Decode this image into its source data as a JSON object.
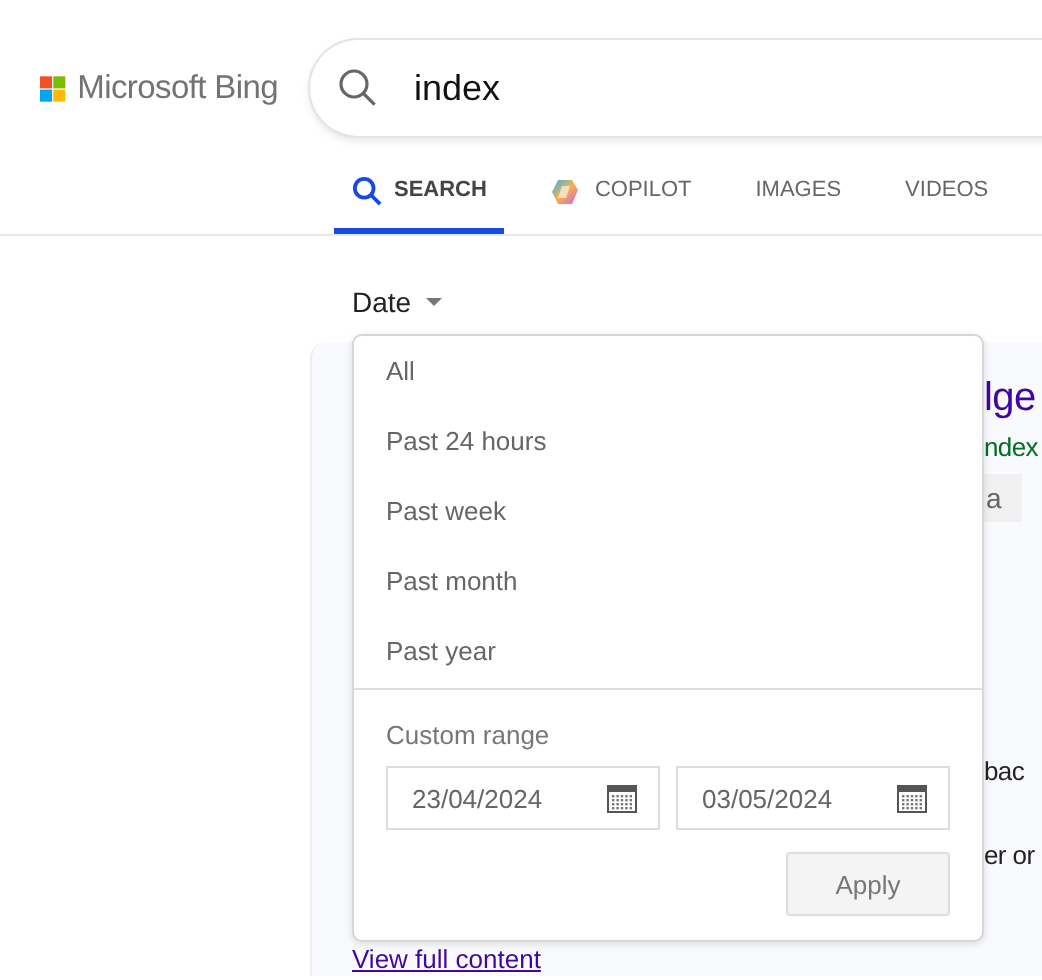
{
  "header": {
    "logo_text": "Microsoft Bing",
    "search": {
      "value": "index"
    }
  },
  "tabs": [
    {
      "label": "SEARCH",
      "selected": true,
      "kind": "search"
    },
    {
      "label": "COPILOT",
      "selected": false,
      "kind": "copilot"
    },
    {
      "label": "IMAGES",
      "selected": false,
      "kind": "plain"
    },
    {
      "label": "VIDEOS",
      "selected": false,
      "kind": "plain"
    }
  ],
  "filter": {
    "label": "Date",
    "expanded": true
  },
  "date_menu": {
    "options": [
      "All",
      "Past 24 hours",
      "Past week",
      "Past month",
      "Past year"
    ],
    "custom_range": {
      "label": "Custom range",
      "from": "23/04/2024",
      "to": "03/05/2024",
      "button": "Apply"
    }
  },
  "result": {
    "title": "lge",
    "url": "ndex",
    "chip": "a",
    "line_1": "bac",
    "line_2": "er or",
    "link": "View full content"
  }
}
